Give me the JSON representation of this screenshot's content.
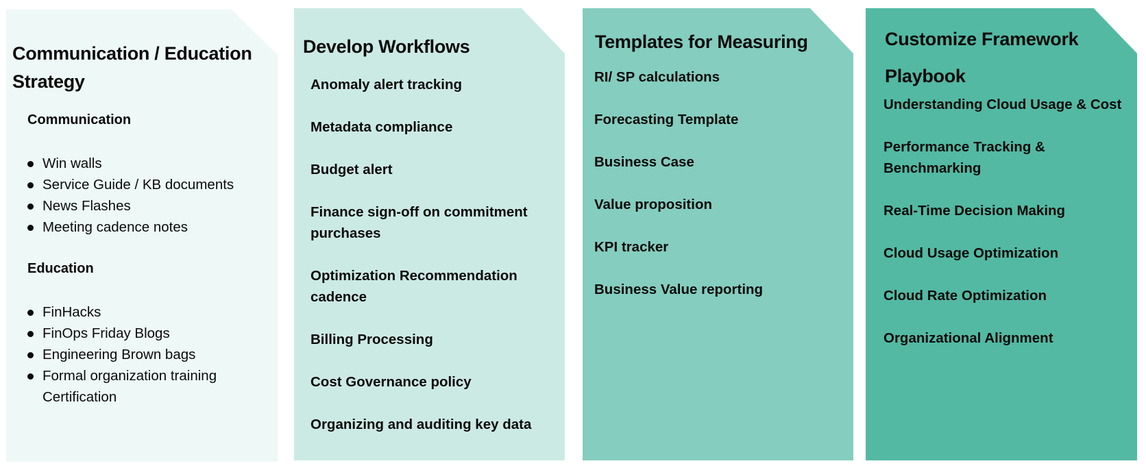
{
  "colors": {
    "panel1": "#EEF8F7",
    "panel2": "#CCEAE4",
    "panel3": "#84CDBF",
    "panel4": "#53B9A3",
    "text": "#0A0A0A"
  },
  "panels": [
    {
      "title": "Communication / Education Strategy",
      "sections": [
        {
          "heading": "Communication",
          "items": [
            "Win walls",
            "Service Guide / KB documents",
            "News Flashes",
            "Meeting cadence notes"
          ]
        },
        {
          "heading": "Education",
          "items": [
            "FinHacks",
            "FinOps Friday Blogs",
            "Engineering Brown bags",
            "Formal organization training Certification"
          ]
        }
      ]
    },
    {
      "title": "Develop Workflows",
      "items": [
        "Anomaly alert tracking",
        "Metadata compliance",
        "Budget alert",
        "Finance sign-off on commitment purchases",
        "Optimization Recommendation cadence",
        "Billing Processing",
        "Cost Governance policy",
        "Organizing and auditing key data"
      ]
    },
    {
      "title": "Templates for Measuring",
      "items": [
        "RI/ SP calculations",
        "Forecasting Template",
        "Business Case",
        "Value proposition",
        "KPI tracker",
        "Business Value reporting"
      ]
    },
    {
      "title": "Customize Framework Playbook",
      "items": [
        "Understanding Cloud Usage & Cost",
        "Performance Tracking & Benchmarking",
        "Real-Time Decision Making",
        "Cloud Usage Optimization",
        "Cloud Rate Optimization",
        "Organizational Alignment"
      ]
    }
  ]
}
